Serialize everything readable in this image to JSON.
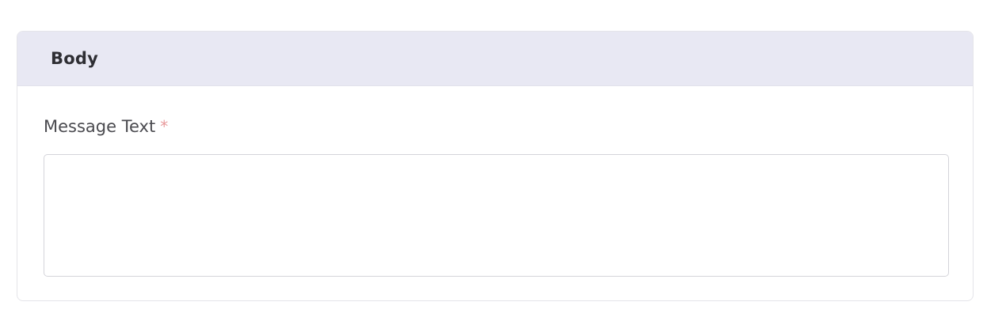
{
  "panel": {
    "title": "Body"
  },
  "field": {
    "label": "Message Text",
    "required_marker": "*",
    "value": "",
    "placeholder": ""
  },
  "colors": {
    "header_background": "#e8e8f3",
    "required_marker": "#e8999b",
    "border": "#d4d4da"
  }
}
